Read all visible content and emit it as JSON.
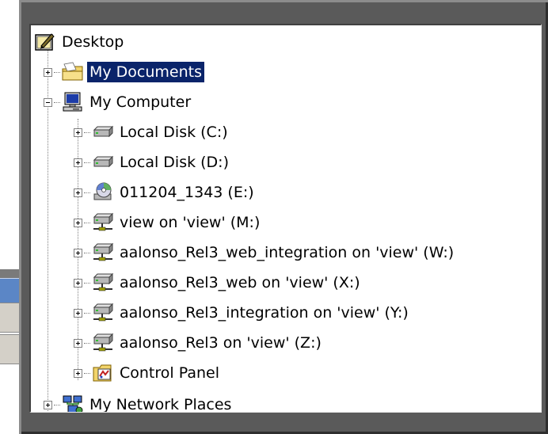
{
  "tree": {
    "items": [
      {
        "label": "Desktop",
        "icon": "desktop-icon",
        "level": 0,
        "expander": "none",
        "selected": false
      },
      {
        "label": "My Documents",
        "icon": "my-documents-folder-icon",
        "level": 1,
        "expander": "plus",
        "selected": true
      },
      {
        "label": "My Computer",
        "icon": "my-computer-icon",
        "level": 1,
        "expander": "minus",
        "selected": false
      },
      {
        "label": "Local Disk (C:)",
        "icon": "hard-drive-icon",
        "level": 2,
        "expander": "plus",
        "selected": false
      },
      {
        "label": "Local Disk (D:)",
        "icon": "hard-drive-icon",
        "level": 2,
        "expander": "plus",
        "selected": false
      },
      {
        "label": "011204_1343 (E:)",
        "icon": "cd-drive-icon",
        "level": 2,
        "expander": "plus",
        "selected": false
      },
      {
        "label": "view on 'view' (M:)",
        "icon": "network-drive-icon",
        "level": 2,
        "expander": "plus",
        "selected": false
      },
      {
        "label": "aalonso_Rel3_web_integration on 'view' (W:)",
        "icon": "network-drive-icon",
        "level": 2,
        "expander": "plus",
        "selected": false
      },
      {
        "label": "aalonso_Rel3_web on 'view' (X:)",
        "icon": "network-drive-icon",
        "level": 2,
        "expander": "plus",
        "selected": false
      },
      {
        "label": "aalonso_Rel3_integration on 'view' (Y:)",
        "icon": "network-drive-icon",
        "level": 2,
        "expander": "plus",
        "selected": false
      },
      {
        "label": "aalonso_Rel3 on 'view' (Z:)",
        "icon": "network-drive-icon",
        "level": 2,
        "expander": "plus",
        "selected": false
      },
      {
        "label": "Control Panel",
        "icon": "control-panel-icon",
        "level": 2,
        "expander": "plus",
        "selected": false
      },
      {
        "label": "My Network Places",
        "icon": "network-places-icon",
        "level": 1,
        "expander": "plus",
        "selected": false
      }
    ]
  },
  "colors": {
    "selection": "#0a246a",
    "frame": "#5a5a5a",
    "tree_background": "#ffffff"
  }
}
